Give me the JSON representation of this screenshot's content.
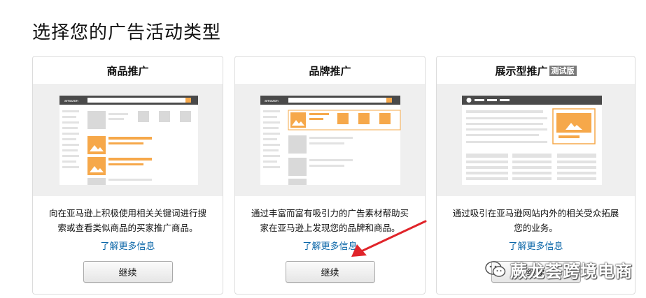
{
  "page": {
    "title": "选择您的广告活动类型"
  },
  "cards": [
    {
      "title": "商品推广",
      "description": "向在亚马逊上积极使用相关关键词进行搜索或查看类似商品的买家推广商品。",
      "learn_more": "了解更多信息",
      "button": "继续",
      "illustration_brand": "amazon"
    },
    {
      "title": "品牌推广",
      "description": "通过丰富而富有吸引力的广告素材帮助买家在亚马逊上发现您的品牌和商品。",
      "learn_more": "了解更多信息",
      "button": "继续",
      "illustration_brand": "amazon"
    },
    {
      "title": "展示型推广",
      "badge": "测试版",
      "description": "通过吸引在亚马逊网站内外的相关受众拓展您的业务。",
      "learn_more": "了解更多信息",
      "button": "继续"
    }
  ],
  "watermark": {
    "text": "蕨龙荟跨境电商",
    "icon": "wechat-icon"
  },
  "colors": {
    "accent_orange": "#f6a84a",
    "link_blue": "#0a66a8",
    "annotation_red": "#e0242a",
    "header_dark": "#4a4a4a"
  }
}
